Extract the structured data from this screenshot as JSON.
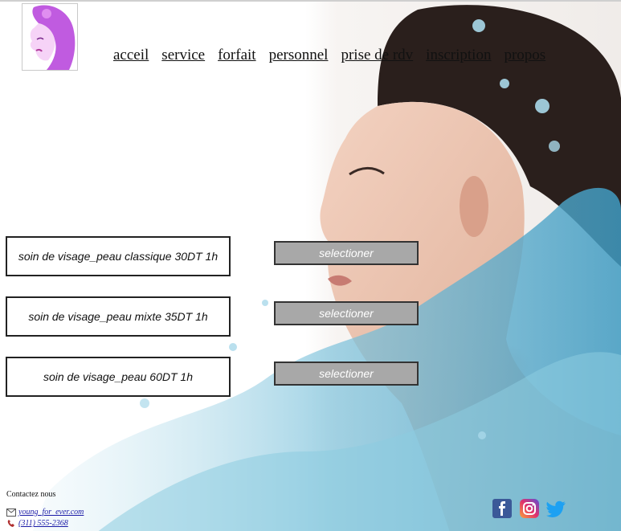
{
  "nav": {
    "items": [
      "acceil",
      "service",
      "forfait",
      "personnel",
      "prise de rdv",
      "inscription",
      "propos"
    ]
  },
  "services": [
    {
      "label": "soin de visage_peau classique 30DT 1h",
      "button": "selectioner"
    },
    {
      "label": "soin de visage_peau mixte 35DT 1h",
      "button": "selectioner"
    },
    {
      "label": "soin de visage_peau 60DT 1h",
      "button": "selectioner"
    }
  ],
  "footer": {
    "contact_title": "Contactez nous",
    "email": "young_for_ever.com",
    "phone": "(311) 555-2368"
  },
  "icons": {
    "mail": "mail-icon",
    "phone": "phone-icon",
    "facebook": "facebook-icon",
    "instagram": "instagram-icon",
    "twitter": "twitter-icon"
  },
  "colors": {
    "button_bg": "#a8a8a8",
    "link": "#1a1aa6",
    "facebook": "#3b5998",
    "twitter": "#1da1f2",
    "logo_accent": "#c05be0"
  }
}
